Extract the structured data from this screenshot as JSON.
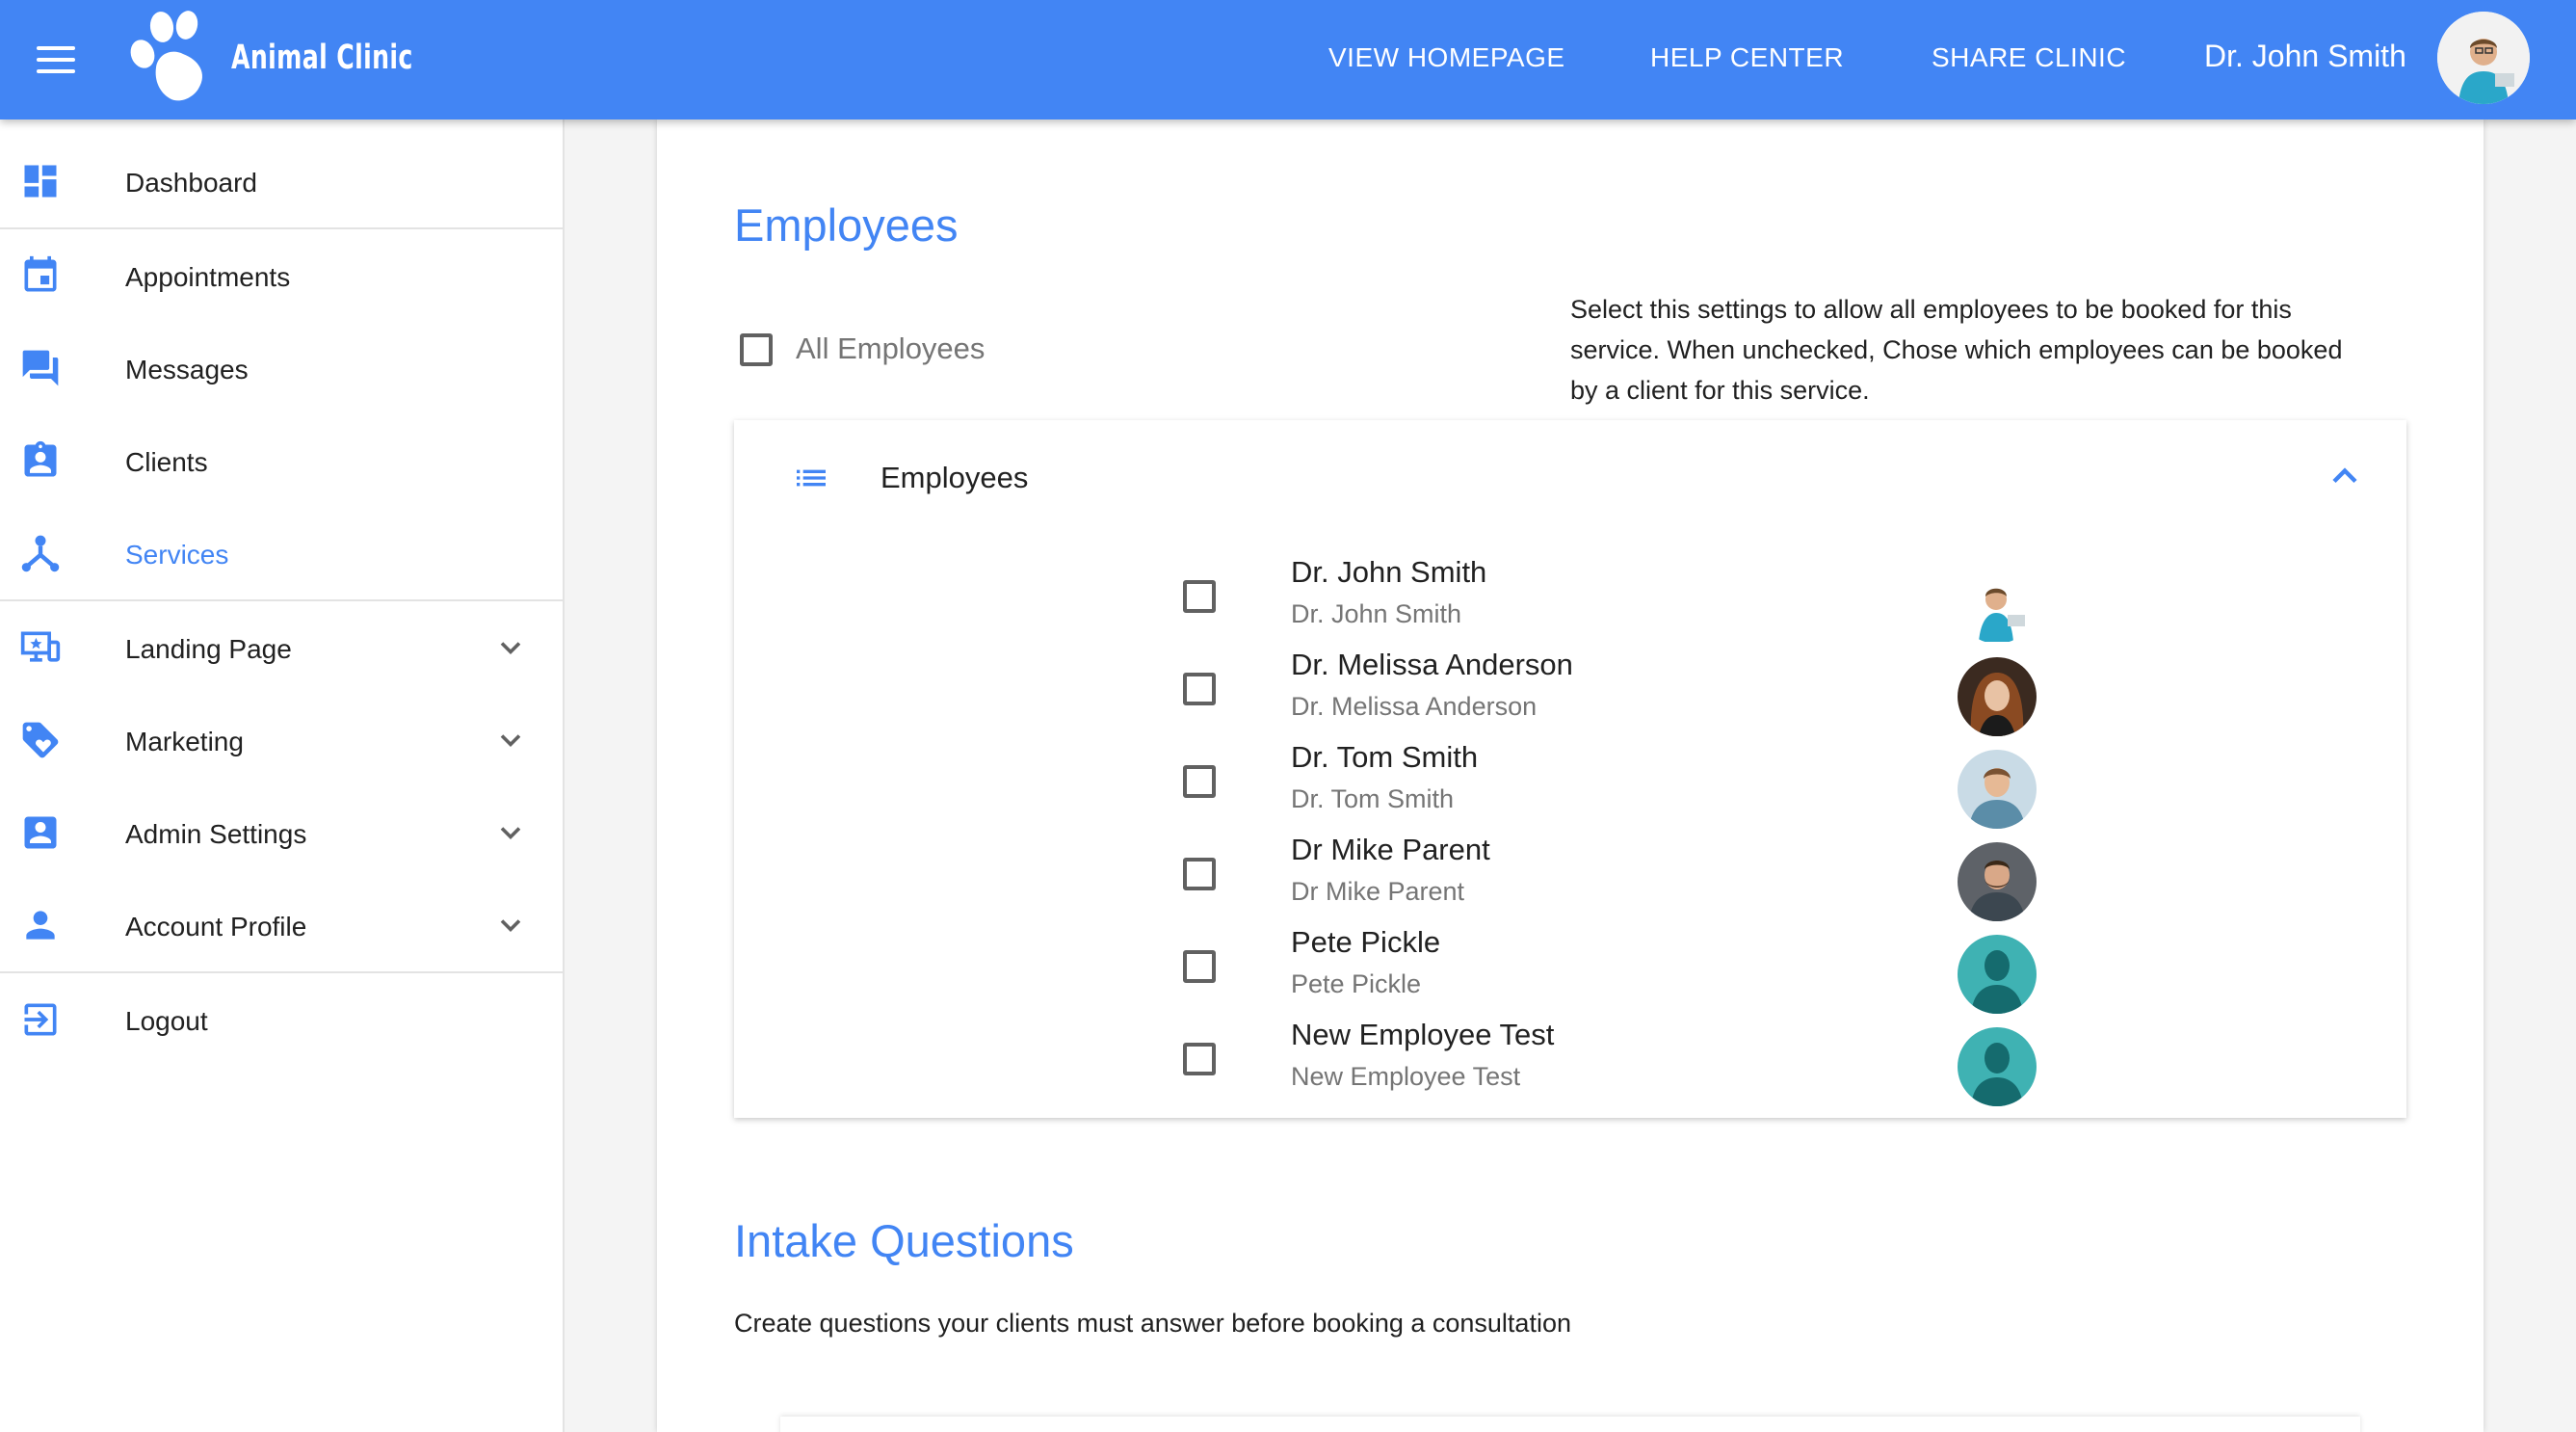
{
  "header": {
    "brand": "Animal Clinic",
    "nav": [
      {
        "label": "VIEW HOMEPAGE"
      },
      {
        "label": "HELP CENTER"
      },
      {
        "label": "SHARE CLINIC"
      }
    ],
    "user_name": "Dr. John Smith",
    "accent": "#4285f4"
  },
  "sidebar": {
    "items": [
      {
        "label": "Dashboard",
        "icon": "dashboard-icon"
      },
      {
        "label": "Appointments",
        "icon": "calendar-icon"
      },
      {
        "label": "Messages",
        "icon": "forum-icon"
      },
      {
        "label": "Clients",
        "icon": "assignment-ind-icon"
      },
      {
        "label": "Services",
        "icon": "hub-icon",
        "active": true
      },
      {
        "label": "Landing Page",
        "icon": "monitor-star-icon",
        "expandable": true
      },
      {
        "label": "Marketing",
        "icon": "loyalty-tag-icon",
        "expandable": true
      },
      {
        "label": "Admin Settings",
        "icon": "account-box-icon",
        "expandable": true
      },
      {
        "label": "Account Profile",
        "icon": "person-icon",
        "expandable": true
      },
      {
        "label": "Logout",
        "icon": "logout-icon"
      }
    ]
  },
  "employees_section": {
    "title": "Employees",
    "all_label": "All Employees",
    "all_checked": false,
    "help_text": "Select this settings to allow all employees to be booked for this service. When unchecked, Chose which employees can be booked by a client for this service.",
    "panel_title": "Employees",
    "panel_expanded": true,
    "employees": [
      {
        "name": "Dr. John Smith",
        "subtitle": "Dr. John Smith",
        "checked": false
      },
      {
        "name": "Dr. Melissa Anderson",
        "subtitle": "Dr. Melissa Anderson",
        "checked": false
      },
      {
        "name": "Dr. Tom Smith",
        "subtitle": "Dr. Tom Smith",
        "checked": false
      },
      {
        "name": "Dr Mike Parent",
        "subtitle": "Dr Mike Parent",
        "checked": false
      },
      {
        "name": "Pete Pickle",
        "subtitle": "Pete Pickle",
        "checked": false
      },
      {
        "name": "New Employee Test",
        "subtitle": "New Employee Test",
        "checked": false
      }
    ]
  },
  "intake_section": {
    "title": "Intake Questions",
    "description": "Create questions your clients must answer before booking a consultation"
  }
}
